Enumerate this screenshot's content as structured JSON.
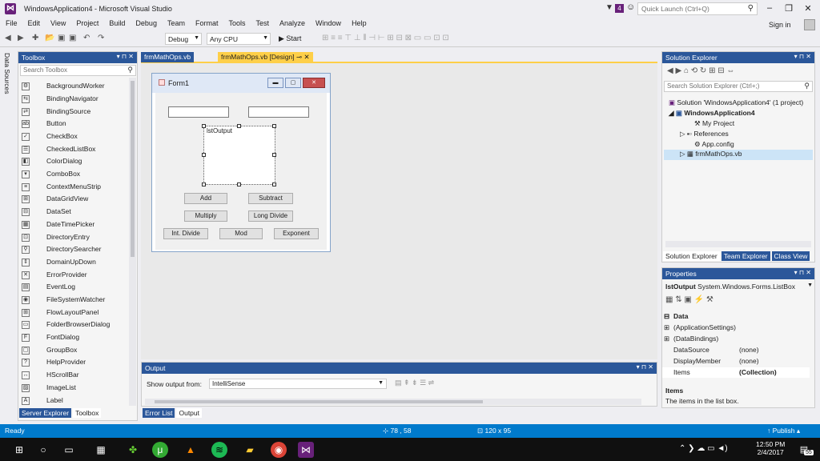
{
  "window": {
    "title": "WindowsApplication4 - Microsoft Visual Studio",
    "notif_count": "4",
    "quick_launch_placeholder": "Quick Launch (Ctrl+Q)",
    "sign_in": "Sign in"
  },
  "menu": [
    "File",
    "Edit",
    "View",
    "Project",
    "Build",
    "Debug",
    "Team",
    "Format",
    "Tools",
    "Test",
    "Analyze",
    "Window",
    "Help"
  ],
  "toolbar": {
    "config": "Debug",
    "platform": "Any CPU",
    "start": "▶ Start"
  },
  "left_strip": "Data Sources",
  "toolbox": {
    "title": "Toolbox",
    "search_placeholder": "Search Toolbox",
    "items": [
      "BackgroundWorker",
      "BindingNavigator",
      "BindingSource",
      "Button",
      "CheckBox",
      "CheckedListBox",
      "ColorDialog",
      "ComboBox",
      "ContextMenuStrip",
      "DataGridView",
      "DataSet",
      "DateTimePicker",
      "DirectoryEntry",
      "DirectorySearcher",
      "DomainUpDown",
      "ErrorProvider",
      "EventLog",
      "FileSystemWatcher",
      "FlowLayoutPanel",
      "FolderBrowserDialog",
      "FontDialog",
      "GroupBox",
      "HelpProvider",
      "HScrollBar",
      "ImageList",
      "Label"
    ],
    "bottom_tabs": [
      "Server Explorer",
      "Toolbox"
    ]
  },
  "doc_tabs": {
    "inactive": "frmMathOps.vb",
    "active": "frmMathOps.vb [Design]"
  },
  "form": {
    "title": "Form1",
    "listbox_label": "lstOutput",
    "buttons": {
      "add": "Add",
      "subtract": "Subtract",
      "multiply": "Multiply",
      "long_divide": "Long Divide",
      "int_divide": "Int. Divide",
      "mod": "Mod",
      "exponent": "Exponent"
    }
  },
  "output": {
    "title": "Output",
    "label": "Show output from:",
    "source": "IntelliSense",
    "bottom_tabs": [
      "Error List",
      "Output"
    ]
  },
  "solution_explorer": {
    "title": "Solution Explorer",
    "search_placeholder": "Search Solution Explorer (Ctrl+;)",
    "solution": "Solution 'WindowsApplication4' (1 project)",
    "project": "WindowsApplication4",
    "items": [
      "My Project",
      "References",
      "App.config",
      "frmMathOps.vb"
    ],
    "bottom_tabs": [
      "Solution Explorer",
      "Team Explorer",
      "Class View"
    ]
  },
  "properties": {
    "title": "Properties",
    "object": "lstOutput",
    "object_type": "System.Windows.Forms.ListBox",
    "category": "Data",
    "rows": [
      {
        "name": "(ApplicationSettings)",
        "value": ""
      },
      {
        "name": "(DataBindings)",
        "value": ""
      },
      {
        "name": "DataSource",
        "value": "(none)"
      },
      {
        "name": "DisplayMember",
        "value": "(none)"
      },
      {
        "name": "Items",
        "value": "(Collection)"
      }
    ],
    "desc_title": "Items",
    "desc_text": "The items in the list box."
  },
  "status": {
    "ready": "Ready",
    "pos": "78 , 58",
    "size": "120 x 95",
    "publish": "↑ Publish ▴"
  },
  "taskbar": {
    "time": "12:50 PM",
    "date": "2/4/2017",
    "notif": "55"
  },
  "colors": {
    "accent": "#007acc",
    "panel_header": "#2b579a",
    "vs_purple": "#68217a"
  }
}
